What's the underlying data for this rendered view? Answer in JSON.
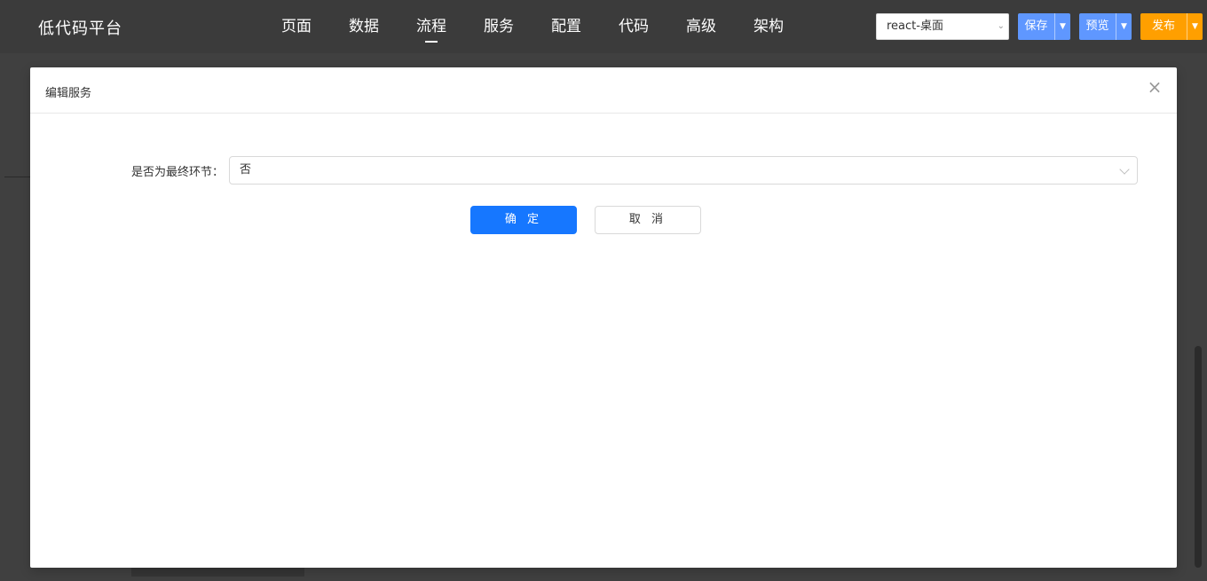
{
  "app": {
    "title": "低代码平台"
  },
  "nav": {
    "items": [
      "页面",
      "数据",
      "流程",
      "服务",
      "配置",
      "代码",
      "高级",
      "架构"
    ],
    "active": "流程"
  },
  "header": {
    "platform_select_value": "react-桌面",
    "save_label": "保存",
    "preview_label": "预览",
    "publish_label": "发布"
  },
  "colors": {
    "primary": "#1677ff",
    "save_preview": "#5f97ff",
    "publish": "#ff9f00",
    "topbar": "#3b3b3b"
  },
  "modal": {
    "title": "编辑服务",
    "form": {
      "final_step_label": "是否为最终环节：",
      "final_step_value": "否"
    },
    "ok_label": "确 定",
    "cancel_label": "取 消"
  }
}
